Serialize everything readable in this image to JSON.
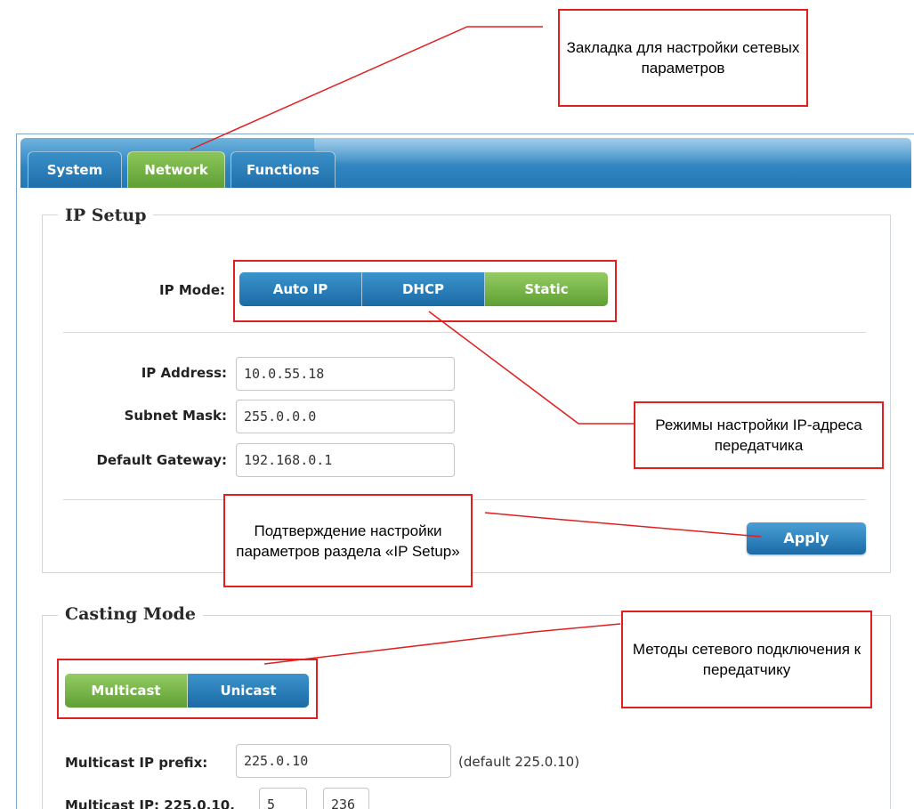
{
  "tabs": [
    {
      "label": "System",
      "active": false
    },
    {
      "label": "Network",
      "active": true
    },
    {
      "label": "Functions",
      "active": false
    }
  ],
  "ip_setup": {
    "title": "IP Setup",
    "ip_mode_label": "IP Mode:",
    "modes": [
      {
        "label": "Auto IP",
        "selected": false
      },
      {
        "label": "DHCP",
        "selected": false
      },
      {
        "label": "Static",
        "selected": true
      }
    ],
    "fields": [
      {
        "label": "IP Address:",
        "value": "10.0.55.18"
      },
      {
        "label": "Subnet Mask:",
        "value": "255.0.0.0"
      },
      {
        "label": "Default Gateway:",
        "value": "192.168.0.1"
      }
    ],
    "apply_label": "Apply"
  },
  "casting_mode": {
    "title": "Casting Mode",
    "options": [
      {
        "label": "Multicast",
        "selected": true
      },
      {
        "label": "Unicast",
        "selected": false
      }
    ],
    "prefix_label": "Multicast IP prefix:",
    "prefix_value": "225.0.10",
    "prefix_hint": "(default 225.0.10)",
    "cut_label": "Multicast IP: 225.0.10.",
    "cut_value_1": "5",
    "cut_value_2": "236"
  },
  "annotations": {
    "network_tab": "Закладка для настройки сетевых параметров",
    "ip_modes": "Режимы настройки IP-адреса передатчика",
    "apply": "Подтверждение настройки параметров раздела «IP Setup»",
    "casting": "Методы сетевого подключения к передатчику"
  },
  "colors": {
    "tab_active": "#6fae45",
    "tab_inactive": "#2a7ab5",
    "annotation": "#e02020"
  }
}
